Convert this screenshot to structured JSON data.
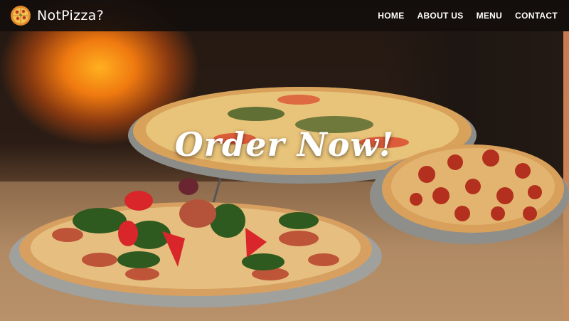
{
  "navbar": {
    "brand_name": "NotPizza?",
    "logo_icon": "pizza-icon",
    "links": [
      {
        "label": "HOME"
      },
      {
        "label": "ABOUT US"
      },
      {
        "label": "MENU"
      },
      {
        "label": "CONTACT"
      }
    ]
  },
  "hero": {
    "title": "Order Now!",
    "background_image": "pizzas-on-stands-photo"
  },
  "colors": {
    "navbar_bg": "#120e0c",
    "nav_text": "#ffffff",
    "hero_text": "#ffffff"
  }
}
